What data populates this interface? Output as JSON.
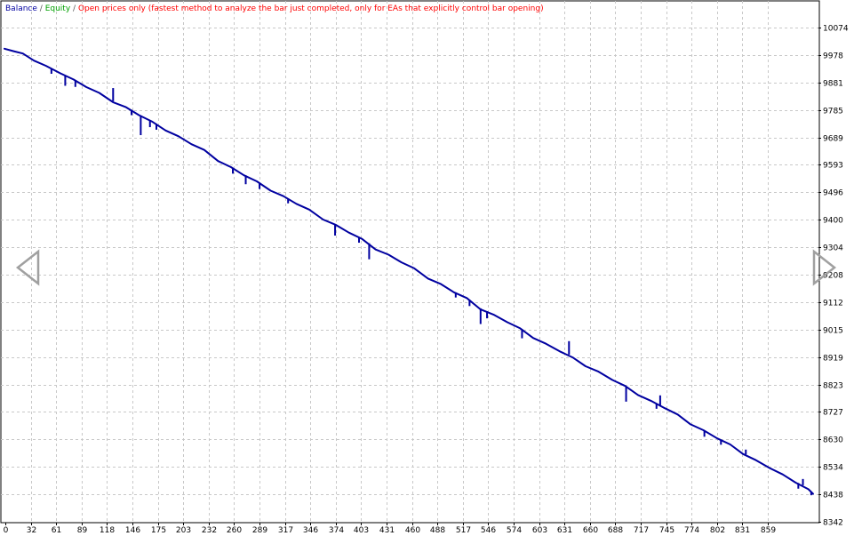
{
  "legend": {
    "balance": "Balance",
    "equity": "Equity",
    "separator": "/",
    "mode": "Open prices only (fastest method to analyze the bar just completed, only for EAs that explicitly control bar opening)"
  },
  "colors": {
    "balance": "#0000A0",
    "equity": "#00A000",
    "mode": "#FF0000",
    "grid": "#C8C8C8",
    "axis": "#000000",
    "nav_arrow": "#A0A0A0"
  },
  "icons": {
    "left": "triangle-left-icon",
    "right": "triangle-right-icon"
  },
  "chart_data": {
    "type": "line",
    "title": "",
    "xlabel": "",
    "ylabel": "",
    "grid": true,
    "legend_position": "top-left",
    "x_ticks": [
      "0",
      "32",
      "61",
      "89",
      "118",
      "146",
      "175",
      "203",
      "232",
      "260",
      "289",
      "317",
      "346",
      "374",
      "403",
      "431",
      "460",
      "488",
      "517",
      "546",
      "574",
      "603",
      "631",
      "660",
      "688",
      "717",
      "745",
      "774",
      "802",
      "831",
      "859"
    ],
    "y_ticks": [
      "10074",
      "9978",
      "9881",
      "9785",
      "9689",
      "9593",
      "9496",
      "9400",
      "9304",
      "9208",
      "9112",
      "9015",
      "8919",
      "8823",
      "8727",
      "8630",
      "8534",
      "8438",
      "8342"
    ],
    "xlim": [
      0,
      880
    ],
    "ylim": [
      8342,
      10171
    ],
    "series": [
      {
        "name": "Balance",
        "x": [
          0,
          10,
          20,
          32,
          45,
          61,
          75,
          89,
          103,
          118,
          132,
          146,
          160,
          175,
          189,
          203,
          217,
          232,
          246,
          260,
          274,
          289,
          303,
          317,
          331,
          346,
          360,
          374,
          388,
          403,
          417,
          431,
          445,
          460,
          474,
          488,
          502,
          517,
          531,
          546,
          560,
          574,
          588,
          603,
          617,
          631,
          645,
          660,
          674,
          688,
          702,
          717,
          731,
          745,
          759,
          774,
          788,
          802,
          816,
          831,
          845,
          859,
          873,
          878
        ],
        "y": [
          10000,
          9995,
          9983,
          9962,
          9940,
          9917,
          9892,
          9869,
          9845,
          9816,
          9795,
          9771,
          9745,
          9717,
          9693,
          9669,
          9645,
          9610,
          9585,
          9560,
          9535,
          9506,
          9483,
          9460,
          9436,
          9405,
          9382,
          9359,
          9334,
          9300,
          9278,
          9255,
          9230,
          9198,
          9175,
          9150,
          9126,
          9090,
          9068,
          9045,
          9020,
          8990,
          8966,
          8943,
          8918,
          8891,
          8868,
          8843,
          8818,
          8790,
          8766,
          8744,
          8718,
          8687,
          8663,
          8638,
          8613,
          8583,
          8558,
          8534,
          8508,
          8483,
          8456,
          8444
        ]
      }
    ],
    "spikes": [
      {
        "x": 51,
        "y0": 9930,
        "y1": 9912
      },
      {
        "x": 66,
        "y0": 9905,
        "y1": 9870
      },
      {
        "x": 77,
        "y0": 9888,
        "y1": 9866
      },
      {
        "x": 118,
        "y0": 9816,
        "y1": 9862
      },
      {
        "x": 138,
        "y0": 9786,
        "y1": 9767
      },
      {
        "x": 148,
        "y0": 9766,
        "y1": 9697
      },
      {
        "x": 158,
        "y0": 9748,
        "y1": 9725
      },
      {
        "x": 165,
        "y0": 9737,
        "y1": 9716
      },
      {
        "x": 248,
        "y0": 9582,
        "y1": 9562
      },
      {
        "x": 262,
        "y0": 9556,
        "y1": 9525
      },
      {
        "x": 277,
        "y0": 9530,
        "y1": 9508
      },
      {
        "x": 308,
        "y0": 9475,
        "y1": 9458
      },
      {
        "x": 359,
        "y0": 9383,
        "y1": 9345
      },
      {
        "x": 385,
        "y0": 9340,
        "y1": 9320
      },
      {
        "x": 396,
        "y0": 9318,
        "y1": 9262
      },
      {
        "x": 490,
        "y0": 9146,
        "y1": 9128
      },
      {
        "x": 505,
        "y0": 9120,
        "y1": 9098
      },
      {
        "x": 517,
        "y0": 9090,
        "y1": 9035
      },
      {
        "x": 524,
        "y0": 9080,
        "y1": 9055
      },
      {
        "x": 562,
        "y0": 9017,
        "y1": 8985
      },
      {
        "x": 613,
        "y0": 8928,
        "y1": 8975
      },
      {
        "x": 675,
        "y0": 8814,
        "y1": 8763
      },
      {
        "x": 708,
        "y0": 8756,
        "y1": 8738
      },
      {
        "x": 712,
        "y0": 8750,
        "y1": 8785
      },
      {
        "x": 760,
        "y0": 8661,
        "y1": 8640
      },
      {
        "x": 778,
        "y0": 8630,
        "y1": 8612
      },
      {
        "x": 805,
        "y0": 8578,
        "y1": 8595
      },
      {
        "x": 862,
        "y0": 8478,
        "y1": 8458
      },
      {
        "x": 867,
        "y0": 8470,
        "y1": 8492
      },
      {
        "x": 876,
        "y0": 8448,
        "y1": 8435
      }
    ]
  }
}
